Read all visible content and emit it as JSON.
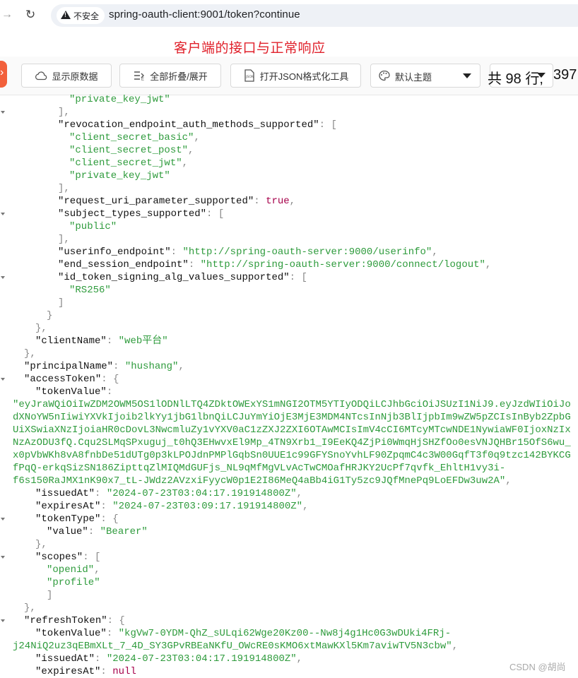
{
  "browser": {
    "security_label": "不安全",
    "url": "spring-oauth-client:9001/token?continue"
  },
  "annotation": "客户端的接口与正常响应",
  "toolbar": {
    "raw_label": "显示原数据",
    "fold_label": "全部折叠/展开",
    "json_tool_label": "打开JSON格式化工具",
    "theme_label": "默认主题",
    "lines_label": "共 98 行,",
    "chars_label": "397"
  },
  "json_lines": [
    {
      "indent": 6,
      "parts": [
        [
          "s",
          "\"private_key_jwt\""
        ]
      ]
    },
    {
      "indent": 5,
      "parts": [
        [
          "p",
          "],"
        ]
      ],
      "fold": true
    },
    {
      "indent": 5,
      "parts": [
        [
          "k",
          "\"revocation_endpoint_auth_methods_supported\""
        ],
        [
          "p",
          ": ["
        ]
      ]
    },
    {
      "indent": 6,
      "parts": [
        [
          "s",
          "\"client_secret_basic\""
        ],
        [
          "p",
          ","
        ]
      ]
    },
    {
      "indent": 6,
      "parts": [
        [
          "s",
          "\"client_secret_post\""
        ],
        [
          "p",
          ","
        ]
      ]
    },
    {
      "indent": 6,
      "parts": [
        [
          "s",
          "\"client_secret_jwt\""
        ],
        [
          "p",
          ","
        ]
      ]
    },
    {
      "indent": 6,
      "parts": [
        [
          "s",
          "\"private_key_jwt\""
        ]
      ]
    },
    {
      "indent": 5,
      "parts": [
        [
          "p",
          "],"
        ]
      ]
    },
    {
      "indent": 5,
      "parts": [
        [
          "k",
          "\"request_uri_parameter_supported\""
        ],
        [
          "p",
          ": "
        ],
        [
          "b",
          "true"
        ],
        [
          "p",
          ","
        ]
      ]
    },
    {
      "indent": 5,
      "parts": [
        [
          "k",
          "\"subject_types_supported\""
        ],
        [
          "p",
          ": ["
        ]
      ],
      "fold": true
    },
    {
      "indent": 6,
      "parts": [
        [
          "s",
          "\"public\""
        ]
      ]
    },
    {
      "indent": 5,
      "parts": [
        [
          "p",
          "],"
        ]
      ]
    },
    {
      "indent": 5,
      "parts": [
        [
          "k",
          "\"userinfo_endpoint\""
        ],
        [
          "p",
          ": "
        ],
        [
          "s",
          "\"http://spring-oauth-server:9000/userinfo\""
        ],
        [
          "p",
          ","
        ]
      ]
    },
    {
      "indent": 5,
      "parts": [
        [
          "k",
          "\"end_session_endpoint\""
        ],
        [
          "p",
          ": "
        ],
        [
          "s",
          "\"http://spring-oauth-server:9000/connect/logout\""
        ],
        [
          "p",
          ","
        ]
      ]
    },
    {
      "indent": 5,
      "parts": [
        [
          "k",
          "\"id_token_signing_alg_values_supported\""
        ],
        [
          "p",
          ": ["
        ]
      ],
      "fold": true
    },
    {
      "indent": 6,
      "parts": [
        [
          "s",
          "\"RS256\""
        ]
      ]
    },
    {
      "indent": 5,
      "parts": [
        [
          "p",
          "]"
        ]
      ]
    },
    {
      "indent": 4,
      "parts": [
        [
          "p",
          "}"
        ]
      ]
    },
    {
      "indent": 3,
      "parts": [
        [
          "p",
          "},"
        ]
      ]
    },
    {
      "indent": 3,
      "parts": [
        [
          "k",
          "\"clientName\""
        ],
        [
          "p",
          ": "
        ],
        [
          "s",
          "\"web平台\""
        ]
      ]
    },
    {
      "indent": 2,
      "parts": [
        [
          "p",
          "},"
        ]
      ]
    },
    {
      "indent": 2,
      "parts": [
        [
          "k",
          "\"principalName\""
        ],
        [
          "p",
          ": "
        ],
        [
          "s",
          "\"hushang\""
        ],
        [
          "p",
          ","
        ]
      ]
    },
    {
      "indent": 2,
      "parts": [
        [
          "k",
          "\"accessToken\""
        ],
        [
          "p",
          ": {"
        ]
      ],
      "fold": true
    },
    {
      "indent": 3,
      "parts": [
        [
          "k",
          "\"tokenValue\""
        ],
        [
          "p",
          ":"
        ]
      ]
    },
    {
      "indent": 1,
      "parts": [
        [
          "s",
          "\"eyJraWQiOiIwZDM2OWM5OS1lODNlLTQ4ZDktOWExYS1mNGI2OTM5YTIyODQiLCJhbGciOiJSUzI1NiJ9.eyJzdWIiOiJo"
        ]
      ]
    },
    {
      "indent": 1,
      "parts": [
        [
          "s",
          "dXNoYW5nIiwiYXVkIjoib2lkYy1jbG1lbnQiLCJuYmYiOjE3MjE3MDM4NTcsInNjb3BlIjpbIm9wZW5pZCIsInByb2ZpbG"
        ]
      ]
    },
    {
      "indent": 1,
      "parts": [
        [
          "s",
          "UiXSwiaXNzIjoiaHR0cDovL3NwcmluZy1vYXV0aC1zZXJ2ZXI6OTAwMCIsImV4cCI6MTcyMTcwNDE1NywiaWF0IjoxNzIx"
        ]
      ]
    },
    {
      "indent": 1,
      "parts": [
        [
          "s",
          "NzAzODU3fQ.Cqu2SLMqSPxuguj_t0hQ3EHwvxEl9Mp_4TN9Xrb1_I9EeKQ4ZjPi0WmqHjSHZfOo0esVNJQHBr15OfS6wu_"
        ]
      ]
    },
    {
      "indent": 1,
      "parts": [
        [
          "s",
          "x0pVbWKh8vA8fnbDe51dUTg0p3kLPOJdnPMPlGqbSn0UUE1c99GFYSnoYvhLF90ZpqmC4c3W00GqfT3f0q9tzc142BYKCG"
        ]
      ]
    },
    {
      "indent": 1,
      "parts": [
        [
          "s",
          "fPqQ-erkqSizSN186ZipttqZlMIQMdGUFjs_NL9qMfMgVLvAcTwCMOafHRJKY2UcPf7qvfk_EhltH1vy3i-"
        ]
      ]
    },
    {
      "indent": 1,
      "parts": [
        [
          "s",
          "f6s150RaJMX1nK90x7_tL-JWdz2AVzxiFyycW0p1E2I86MeQ4aBb4iG1Ty5zc9JQfMnePq9LoEFDw3uw2A\""
        ],
        [
          "p",
          ","
        ]
      ]
    },
    {
      "indent": 3,
      "parts": [
        [
          "k",
          "\"issuedAt\""
        ],
        [
          "p",
          ": "
        ],
        [
          "s",
          "\"2024-07-23T03:04:17.191914800Z\""
        ],
        [
          "p",
          ","
        ]
      ]
    },
    {
      "indent": 3,
      "parts": [
        [
          "k",
          "\"expiresAt\""
        ],
        [
          "p",
          ": "
        ],
        [
          "s",
          "\"2024-07-23T03:09:17.191914800Z\""
        ],
        [
          "p",
          ","
        ]
      ]
    },
    {
      "indent": 3,
      "parts": [
        [
          "k",
          "\"tokenType\""
        ],
        [
          "p",
          ": {"
        ]
      ],
      "fold": true
    },
    {
      "indent": 4,
      "parts": [
        [
          "k",
          "\"value\""
        ],
        [
          "p",
          ": "
        ],
        [
          "s",
          "\"Bearer\""
        ]
      ]
    },
    {
      "indent": 3,
      "parts": [
        [
          "p",
          "},"
        ]
      ]
    },
    {
      "indent": 3,
      "parts": [
        [
          "k",
          "\"scopes\""
        ],
        [
          "p",
          ": ["
        ]
      ],
      "fold": true
    },
    {
      "indent": 4,
      "parts": [
        [
          "s",
          "\"openid\""
        ],
        [
          "p",
          ","
        ]
      ]
    },
    {
      "indent": 4,
      "parts": [
        [
          "s",
          "\"profile\""
        ]
      ]
    },
    {
      "indent": 4,
      "parts": [
        [
          "p",
          "]"
        ]
      ]
    },
    {
      "indent": 2,
      "parts": [
        [
          "p",
          "},"
        ]
      ]
    },
    {
      "indent": 2,
      "parts": [
        [
          "k",
          "\"refreshToken\""
        ],
        [
          "p",
          ": {"
        ]
      ],
      "fold": true
    },
    {
      "indent": 3,
      "parts": [
        [
          "k",
          "\"tokenValue\""
        ],
        [
          "p",
          ": "
        ],
        [
          "s",
          "\"kgVw7-0YDM-QhZ_sULqi62Wge20Kz00--Nw8j4g1Hc0G3wDUki4FRj-"
        ]
      ]
    },
    {
      "indent": 1,
      "parts": [
        [
          "s",
          "j24NiQ2uz3qEBmXLt_7_4D_SY3GPvRBEaNKfU_OWcRE0sKMO6xtMawKXl5Km7aviwTV5N3cbw\""
        ],
        [
          "p",
          ","
        ]
      ]
    },
    {
      "indent": 3,
      "parts": [
        [
          "k",
          "\"issuedAt\""
        ],
        [
          "p",
          ": "
        ],
        [
          "s",
          "\"2024-07-23T03:04:17.191914800Z\""
        ],
        [
          "p",
          ","
        ]
      ]
    },
    {
      "indent": 3,
      "parts": [
        [
          "k",
          "\"expiresAt\""
        ],
        [
          "p",
          ": "
        ],
        [
          "b",
          "null"
        ]
      ]
    }
  ],
  "watermark": "CSDN @胡尚"
}
